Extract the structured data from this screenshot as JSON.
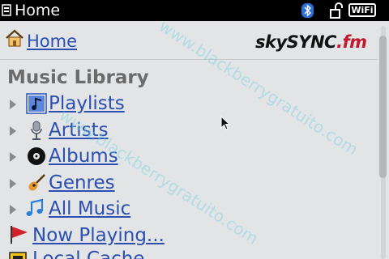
{
  "status_bar": {
    "title": "Home",
    "wifi_label": "WiFi",
    "icons": [
      "app-icon",
      "bluetooth-icon",
      "lock-icon",
      "wifi-icon"
    ]
  },
  "header": {
    "home_link": "Home",
    "logo_text_main": "skySYNC",
    "logo_text_ext": ".fm"
  },
  "section": {
    "title": "Music Library"
  },
  "items": [
    {
      "label": "Playlists",
      "icon": "playlist-icon"
    },
    {
      "label": "Artists",
      "icon": "microphone-icon"
    },
    {
      "label": "Albums",
      "icon": "album-disc-icon"
    },
    {
      "label": "Genres",
      "icon": "guitar-icon"
    },
    {
      "label": "All Music",
      "icon": "music-note-icon"
    },
    {
      "label": "Now Playing...",
      "icon": "flag-icon"
    },
    {
      "label": "Local Cache",
      "icon": "folder-icon"
    }
  ],
  "watermark": {
    "text": "www.blackberrygratuito.com"
  },
  "colors": {
    "background": "#e2e4e5",
    "link": "#2a4fb0",
    "status_bar": "#000000",
    "section_title": "#6b6b6b",
    "logo_accent": "#c2182b"
  }
}
